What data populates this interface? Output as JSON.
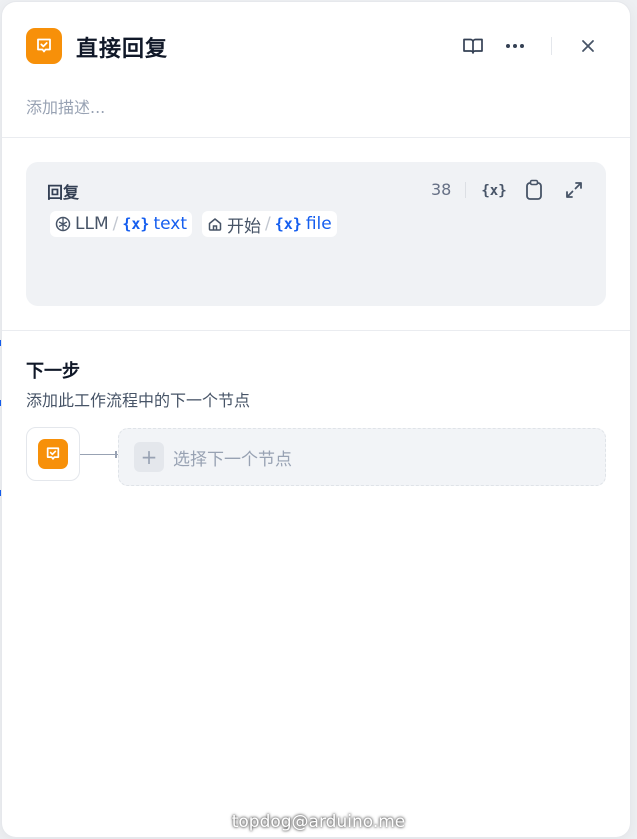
{
  "header": {
    "title": "直接回复",
    "description_placeholder": "添加描述..."
  },
  "reply": {
    "label": "回复",
    "char_count": "38",
    "variables": [
      {
        "source": "LLM",
        "name": "text",
        "source_icon": "llm-icon"
      },
      {
        "source": "开始",
        "name": "file",
        "source_icon": "home-icon"
      }
    ]
  },
  "next_step": {
    "title": "下一步",
    "description": "添加此工作流程中的下一个节点",
    "select_label": "选择下一个节点"
  },
  "watermark": "topdog@arduino.me",
  "colors": {
    "node_accent": "#f79009",
    "variable_blue": "#155eef"
  }
}
